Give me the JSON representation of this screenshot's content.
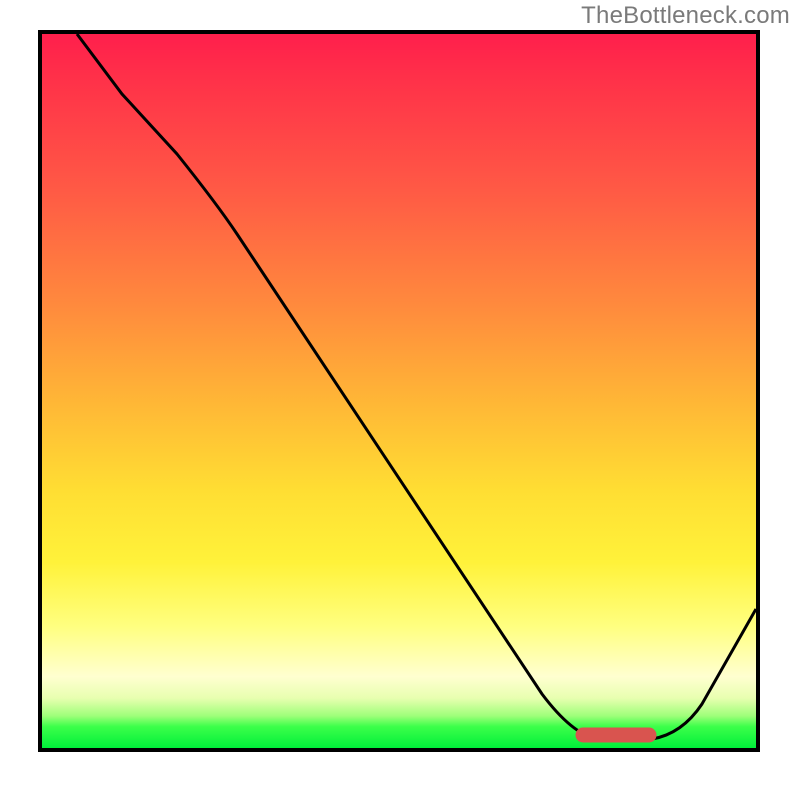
{
  "watermark": "TheBottleneck.com",
  "chart_data": {
    "type": "line",
    "title": "",
    "xlabel": "",
    "ylabel": "",
    "xlim": [
      0,
      100
    ],
    "ylim": [
      0,
      100
    ],
    "x": [
      5,
      10,
      15,
      20,
      25,
      30,
      35,
      40,
      45,
      50,
      55,
      60,
      65,
      70,
      75,
      80,
      82,
      85,
      90,
      95,
      100
    ],
    "values": [
      100,
      93,
      86,
      79,
      72,
      66,
      60,
      53,
      46,
      40,
      33,
      26,
      19,
      12,
      6,
      2,
      0,
      0,
      4,
      12,
      20
    ],
    "optimal_range_x": [
      75,
      86
    ],
    "optimal_range_y": 1.2,
    "gradient_note": "background encodes bottleneck severity: red=high, green=optimal"
  }
}
